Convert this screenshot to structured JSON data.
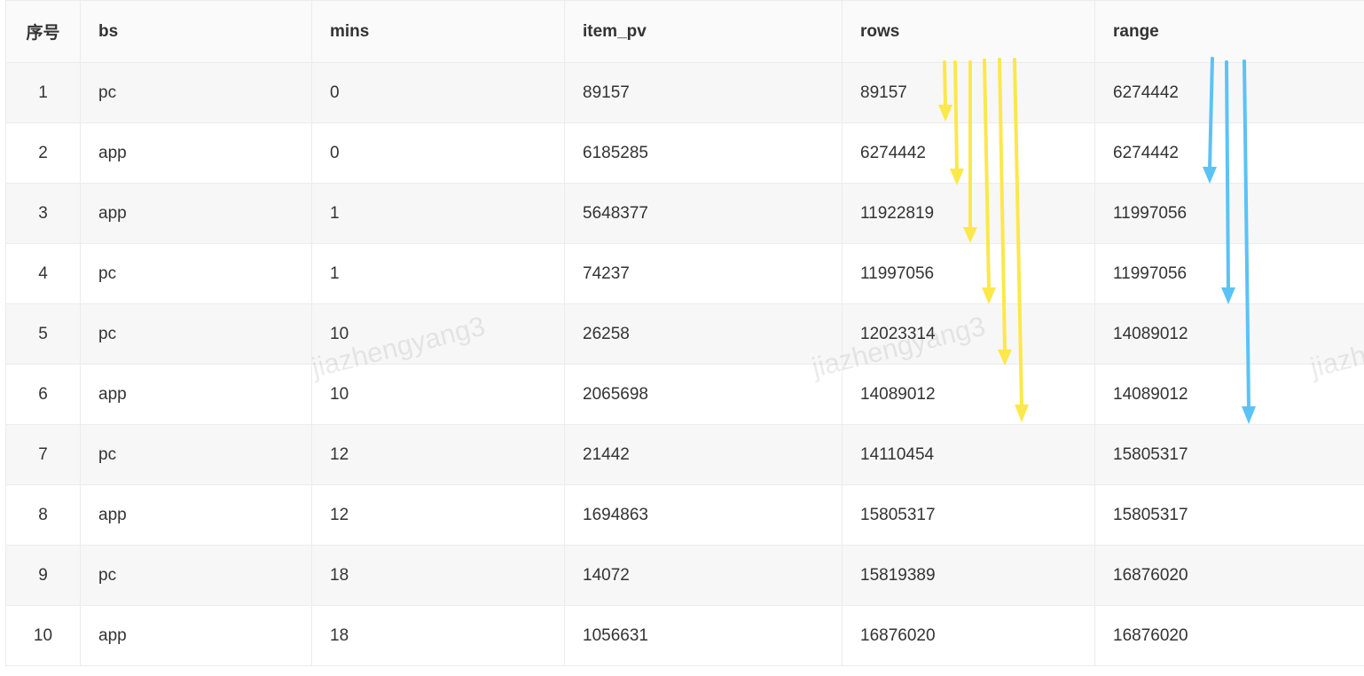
{
  "table": {
    "headers": [
      "序号",
      "bs",
      "mins",
      "item_pv",
      "rows",
      "range"
    ],
    "rows": [
      [
        "1",
        "pc",
        "0",
        "89157",
        "89157",
        "6274442"
      ],
      [
        "2",
        "app",
        "0",
        "6185285",
        "6274442",
        "6274442"
      ],
      [
        "3",
        "app",
        "1",
        "5648377",
        "11922819",
        "11997056"
      ],
      [
        "4",
        "pc",
        "1",
        "74237",
        "11997056",
        "11997056"
      ],
      [
        "5",
        "pc",
        "10",
        "26258",
        "12023314",
        "14089012"
      ],
      [
        "6",
        "app",
        "10",
        "2065698",
        "14089012",
        "14089012"
      ],
      [
        "7",
        "pc",
        "12",
        "21442",
        "14110454",
        "15805317"
      ],
      [
        "8",
        "app",
        "12",
        "1694863",
        "15805317",
        "15805317"
      ],
      [
        "9",
        "pc",
        "18",
        "14072",
        "15819389",
        "16876020"
      ],
      [
        "10",
        "app",
        "18",
        "1056631",
        "16876020",
        "16876020"
      ]
    ]
  },
  "watermark": "jiazhengyang3",
  "colors": {
    "rows_arrows": "#fbe84a",
    "range_arrows": "#5bc2f5",
    "grid_border": "#ececec",
    "stripe": "#f7f7f7"
  }
}
